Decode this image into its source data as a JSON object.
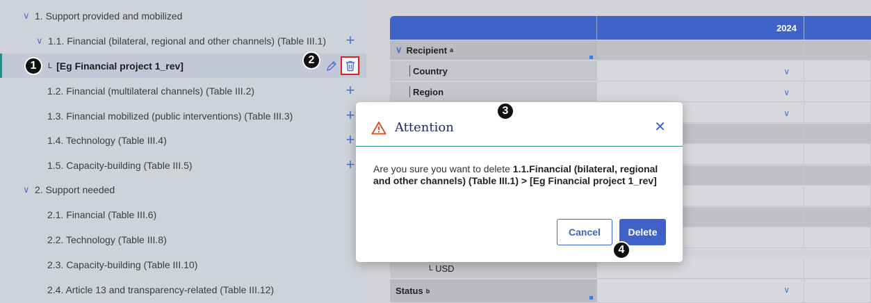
{
  "tree": {
    "items": [
      {
        "label": "1. Support provided and mobilized",
        "level": 0,
        "expanded": true
      },
      {
        "label": "1.1. Financial (bilateral, regional and other channels) (Table III.1)",
        "level": 1,
        "expanded": true,
        "has_add": true
      },
      {
        "label": "[Eg Financial project 1_rev]",
        "level": 2,
        "selected": true
      },
      {
        "label": "1.2. Financial (multilateral channels) (Table III.2)",
        "level": 1,
        "has_add": true
      },
      {
        "label": "1.3. Financial mobilized (public interventions) (Table III.3)",
        "level": 1,
        "has_add": true
      },
      {
        "label": "1.4. Technology (Table III.4)",
        "level": 1,
        "has_add": true
      },
      {
        "label": "1.5. Capacity-building (Table III.5)",
        "level": 1,
        "has_add": true
      },
      {
        "label": "2. Support needed",
        "level": 0,
        "expanded": true
      },
      {
        "label": "2.1. Financial (Table III.6)",
        "level": 1
      },
      {
        "label": "2.2. Technology (Table III.8)",
        "level": 1
      },
      {
        "label": "2.3. Capacity-building (Table III.10)",
        "level": 1
      },
      {
        "label": "2.4. Article 13 and transparency-related (Table III.12)",
        "level": 1
      }
    ],
    "selected_marker": "L",
    "add_symbol": "+",
    "expand_symbol": "∨"
  },
  "grid": {
    "year_header": "2024",
    "rows": {
      "recipient": "Recipient",
      "recipient_sup": "a",
      "country": "Country",
      "region": "Region",
      "usd_marker": "L",
      "usd": "USD",
      "status": "Status",
      "status_sup": "b"
    }
  },
  "dialog": {
    "title": "Attention",
    "message_prefix": "Are you sure you want to delete ",
    "message_bold": "1.1.Financial (bilateral, regional and other channels) (Table III.1) > [Eg Financial project 1_rev]",
    "cancel_label": "Cancel",
    "delete_label": "Delete",
    "close_symbol": "✕"
  },
  "steps": [
    "1",
    "2",
    "3",
    "4"
  ],
  "colors": {
    "accent": "#3f62c9",
    "teal": "#2a8f87",
    "warning": "#d9481c",
    "highlight_border": "#e0201c"
  }
}
